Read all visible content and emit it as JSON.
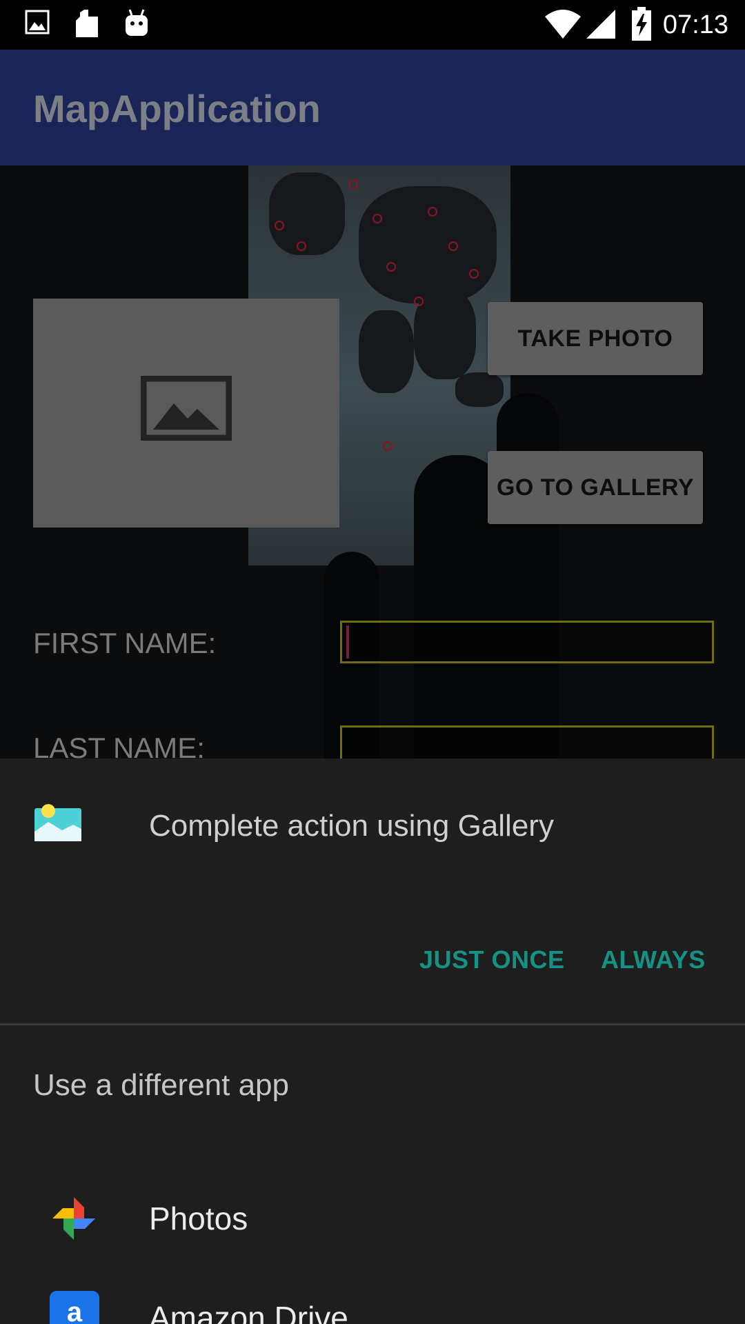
{
  "status_bar": {
    "time": "07:13",
    "left_icons": [
      "image-icon",
      "sd-card-icon",
      "android-icon"
    ],
    "right_icons": [
      "wifi-icon",
      "signal-icon",
      "battery-charging-icon"
    ]
  },
  "app_bar": {
    "title": "MapApplication",
    "color": "#1b2457"
  },
  "main": {
    "image_placeholder_icon": "image-placeholder-icon",
    "take_photo_label": "TAKE PHOTO",
    "go_to_gallery_label": "GO TO GALLERY",
    "first_name_label": "FIRST NAME:",
    "first_name_value": "",
    "last_name_label": "LAST NAME:",
    "last_name_value": ""
  },
  "chooser": {
    "title_icon": "gallery-icon",
    "title": "Complete action using Gallery",
    "just_once_label": "JUST ONCE",
    "always_label": "ALWAYS",
    "accent_color": "#159283",
    "subtitle": "Use a different app",
    "apps": [
      {
        "label": "Photos",
        "icon": "photos-icon"
      },
      {
        "label": "Amazon Drive",
        "icon": "amazon-drive-icon"
      }
    ]
  }
}
